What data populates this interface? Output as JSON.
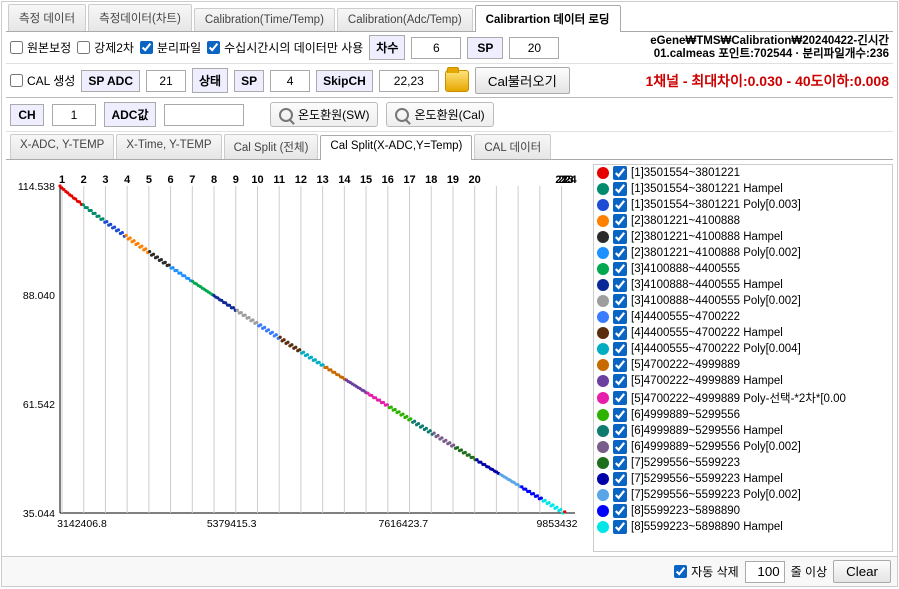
{
  "tabs": [
    "측정 데이터",
    "측정데이터(차트)",
    "Calibration(Time/Temp)",
    "Calibration(Adc/Temp)",
    "Calibrartion 데이터 로딩"
  ],
  "row1": {
    "chk1": "원본보정",
    "chk2": "강제2차",
    "chk3": "분리파일",
    "chk4": "수십시간시의 데이터만 사용",
    "chk3_checked": true,
    "chk4_checked": true,
    "lbl_1": "차수",
    "val_1": "6",
    "lbl_2": "SP",
    "val_2": "20",
    "pathA": "eGene₩TMS₩Calibration₩20240422-긴시간",
    "pathB": "01.calmeas 포인트:702544 · 분리파일개수:236"
  },
  "row2": {
    "chk5": "CAL 생성",
    "lbl_spadc": "SP ADC",
    "val_spadc": "21",
    "lbl_state": "상태",
    "lbl_sp2": "SP",
    "val_sp2": "4",
    "lbl_skip": "SkipCH",
    "val_skip": "22,23",
    "btn_load": "Cal불러오기",
    "status": "1채널 - 최대차이:0.030 - 40도이하:0.008"
  },
  "row3": {
    "ch_lbl": "CH",
    "ch_val": "1",
    "adc_lbl": "ADC값",
    "btn_sw": "온도환원(SW)",
    "btn_cal": "온도환원(Cal)"
  },
  "subtabs": [
    "X-ADC, Y-TEMP",
    "X-Time, Y-TEMP",
    "Cal Split (전체)",
    "Cal Split(X-ADC,Y=Temp)",
    "CAL 데이터"
  ],
  "chart_data": {
    "type": "line",
    "ylim": [
      35.044,
      114.538
    ],
    "yticks": [
      35.044,
      61.542,
      88.04,
      114.538
    ],
    "xlim": [
      3142406.8,
      9853432
    ],
    "xticks": [
      3142406.8,
      5379415.3,
      7616423.7,
      9853432
    ],
    "top_labels": [
      "1",
      "2",
      "3",
      "4",
      "5",
      "6",
      "7",
      "8",
      "9",
      "10",
      "11",
      "12",
      "13",
      "14",
      "15",
      "16",
      "17",
      "18",
      "19",
      "20",
      "21",
      "22",
      "23",
      "24"
    ],
    "series_shape": "monotone decreasing multi-color scatter cloud following a diagonal line from top-left to bottom-right"
  },
  "legend": [
    {
      "color": "#e60000",
      "label": "[1]3501554~3801221",
      "checked": true
    },
    {
      "color": "#008b6d",
      "label": "[1]3501554~3801221 Hampel",
      "checked": true
    },
    {
      "color": "#1e4bd6",
      "label": "[1]3501554~3801221 Poly[0.003]",
      "checked": true
    },
    {
      "color": "#ff7f00",
      "label": "[2]3801221~4100888",
      "checked": true
    },
    {
      "color": "#2a2a2a",
      "label": "[2]3801221~4100888 Hampel",
      "checked": true
    },
    {
      "color": "#1e90ff",
      "label": "[2]3801221~4100888 Poly[0.002]",
      "checked": true
    },
    {
      "color": "#00a84f",
      "label": "[3]4100888~4400555",
      "checked": true
    },
    {
      "color": "#0a2896",
      "label": "[3]4100888~4400555 Hampel",
      "checked": true
    },
    {
      "color": "#9e9e9e",
      "label": "[3]4100888~4400555 Poly[0.002]",
      "checked": true
    },
    {
      "color": "#3b7bff",
      "label": "[4]4400555~4700222",
      "checked": true
    },
    {
      "color": "#5a2d0f",
      "label": "[4]4400555~4700222 Hampel",
      "checked": true
    },
    {
      "color": "#00adc2",
      "label": "[4]4400555~4700222 Poly[0.004]",
      "checked": true
    },
    {
      "color": "#c76a00",
      "label": "[5]4700222~4999889",
      "checked": true
    },
    {
      "color": "#6b3fa0",
      "label": "[5]4700222~4999889 Hampel",
      "checked": true
    },
    {
      "color": "#e61eaa",
      "label": "[5]4700222~4999889 Poly-선택-*2차*[0.00",
      "checked": true
    },
    {
      "color": "#2db200",
      "label": "[6]4999889~5299556",
      "checked": true
    },
    {
      "color": "#0f7a6e",
      "label": "[6]4999889~5299556 Hampel",
      "checked": true
    },
    {
      "color": "#7a5c8a",
      "label": "[6]4999889~5299556 Poly[0.002]",
      "checked": true
    },
    {
      "color": "#1e6e1e",
      "label": "[7]5299556~5599223",
      "checked": true
    },
    {
      "color": "#0000a8",
      "label": "[7]5299556~5599223 Hampel",
      "checked": true
    },
    {
      "color": "#5aa5e6",
      "label": "[7]5299556~5599223 Poly[0.002]",
      "checked": true
    },
    {
      "color": "#0000ff",
      "label": "[8]5599223~5898890",
      "checked": true
    },
    {
      "color": "#00e6e6",
      "label": "[8]5599223~5898890 Hampel",
      "checked": true
    }
  ],
  "footer": {
    "autodel": "자동 삭제",
    "n": "100",
    "unit": "줄 이상",
    "clear": "Clear"
  }
}
